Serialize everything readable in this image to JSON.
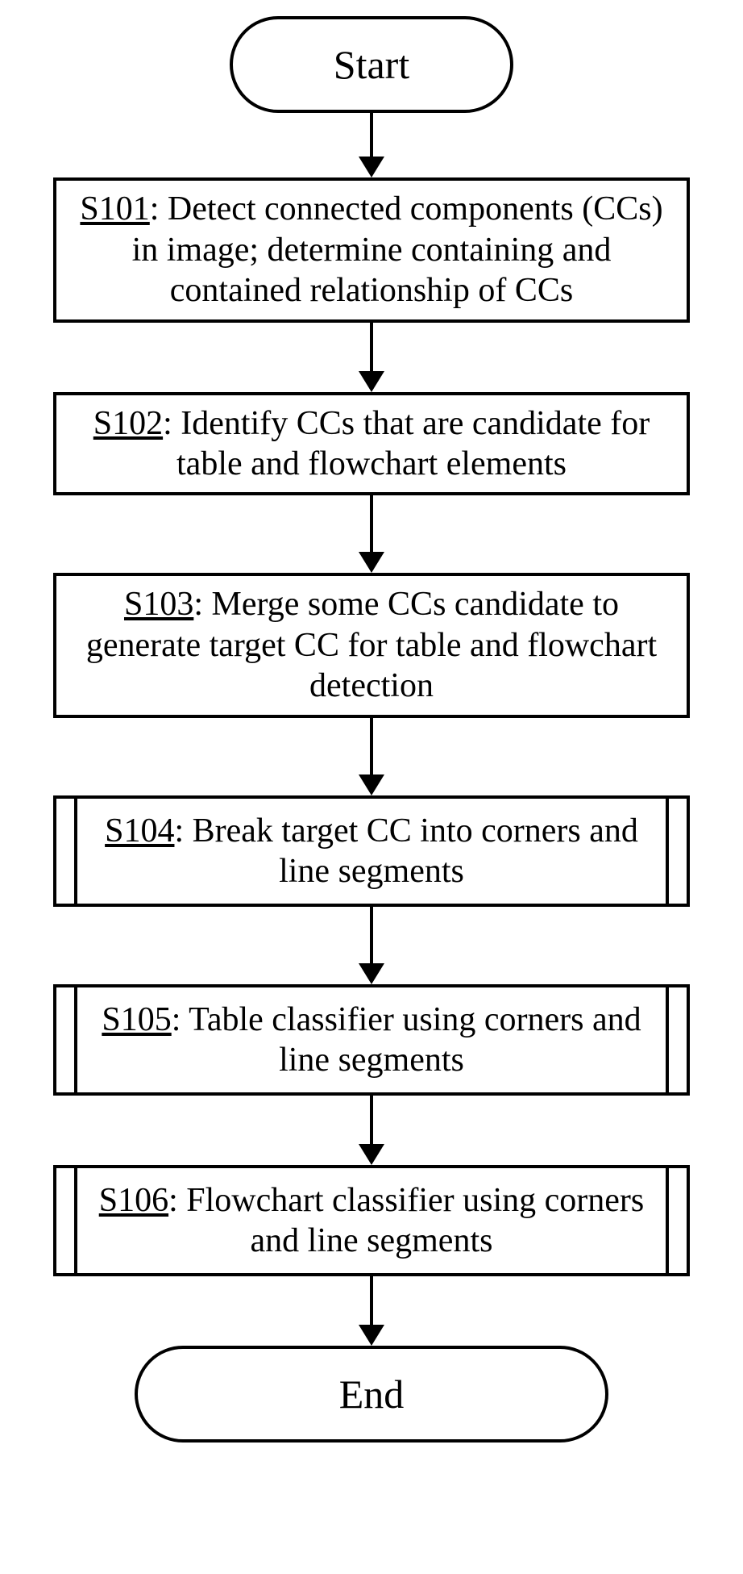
{
  "flowchart": {
    "start": "Start",
    "end": "End",
    "steps": {
      "s101": {
        "id": "S101",
        "text": ": Detect connected components (CCs) in image; determine containing and contained relationship of CCs"
      },
      "s102": {
        "id": "S102",
        "text": ": Identify CCs that are candidate for table and flowchart elements"
      },
      "s103": {
        "id": "S103",
        "text": ": Merge some CCs candidate to generate target CC for table and flowchart detection"
      },
      "s104": {
        "id": "S104",
        "text": ": Break target CC into corners and line segments"
      },
      "s105": {
        "id": "S105",
        "text": ": Table classifier using corners and line segments"
      },
      "s106": {
        "id": "S106",
        "text": ": Flowchart classifier using corners and line segments"
      }
    }
  }
}
